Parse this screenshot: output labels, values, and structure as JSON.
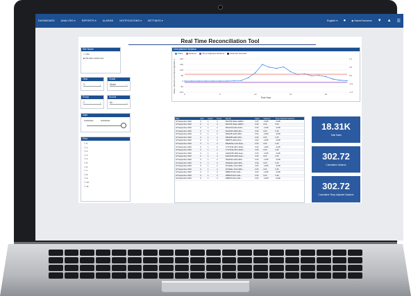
{
  "nav": {
    "items": [
      "DASHBOARD",
      "ANALYSIS ▾",
      "REPORTS ▾",
      "ALARMS",
      "NOTIFICATIONS ▾",
      "SETTINGS ▾"
    ],
    "language": "English ▾",
    "user": "NameSurname"
  },
  "page": {
    "title": "Real Time Reconciliation Tool"
  },
  "site": {
    "header": "Site Name",
    "options": [
      "(All)",
      "ON-Main Addersons"
    ]
  },
  "tank": {
    "header": "Tank",
    "value": "3"
  },
  "grade": {
    "header": "Grade",
    "value": "Diesel"
  },
  "pump": {
    "header": "Pump",
    "value": "2"
  },
  "nozzle": {
    "header": "Nozzle",
    "value": "All"
  },
  "date": {
    "header": "Date",
    "start": "9/18/2020",
    "end": "9/18/2020"
  },
  "hour": {
    "header": "Hour",
    "values": [
      "0",
      "1",
      "2",
      "3",
      "4",
      "5",
      "6",
      "7",
      "8",
      "9",
      "10",
      "11"
    ]
  },
  "chart_data": {
    "type": "line",
    "title": "Unexplained Variance",
    "legend": [
      "Sales",
      "Variance",
      "Temp Adjusted Variance",
      "Selected Intervals"
    ],
    "ylabel": "Sales, Variance and Temp Adjusted V...",
    "xlabel": "Time Hour",
    "x": [
      0,
      1,
      2,
      3,
      4,
      5,
      6,
      7,
      8,
      9,
      10,
      11,
      12,
      13,
      14,
      15,
      16,
      17,
      18,
      19,
      20,
      21,
      22,
      23
    ],
    "ylim": [
      -100,
      200
    ],
    "y_ticks": [
      "200",
      "150",
      "100",
      "50",
      "0",
      "-50",
      "-100"
    ],
    "y2_ticks": [
      "1.0",
      "0.5",
      "0.0",
      "-0.5",
      "-1.0"
    ],
    "x_ticks": [
      "0",
      "5",
      "10",
      "15",
      "20"
    ],
    "colors": {
      "sales": "#2f86e0",
      "variance": "#e64b3c",
      "temp": "#8a3cc4",
      "selected": "#222222"
    },
    "series": [
      {
        "name": "Sales",
        "values": [
          0,
          0,
          0,
          0,
          0,
          0,
          0,
          2,
          5,
          30,
          75,
          150,
          125,
          115,
          128,
          85,
          60,
          65,
          48,
          52,
          40,
          18,
          8,
          4
        ]
      },
      {
        "name": "Temp Adjusted Variance",
        "values": [
          -11.5,
          -11.5,
          -11.5,
          -11.5,
          -11.5,
          -11.5,
          -11.5,
          -11.5,
          -11.5,
          -11.5,
          -11.5,
          -11.5,
          -11.5,
          -11.5,
          -11.5,
          -11.5,
          -11.5,
          -11.5,
          -11.5,
          -11.5,
          -11.5,
          -11.5,
          -11.5,
          -11.5
        ]
      },
      {
        "name": "Variance",
        "values": [
          62,
          62,
          62,
          62,
          62,
          62,
          62,
          62,
          62,
          62,
          62,
          62,
          62,
          62,
          62,
          62,
          62,
          62,
          62,
          62,
          62,
          62,
          62,
          62
        ]
      }
    ]
  },
  "table": {
    "columns": [
      "Date",
      "Hour",
      "Grade",
      "Pump",
      "Nozzle",
      "Sales",
      "Variance",
      "Temp Adjusted Variance"
    ],
    "rows": [
      [
        "18 September 2020",
        "0",
        "1",
        "2",
        "0f2e7f2b-9bae-4e88-b...",
        "0.00",
        "-11.86",
        "-11.86"
      ],
      [
        "18 September 2020",
        "0",
        "1",
        "2",
        "0f2e7f2b-9bae-4e88-b...",
        "0.00",
        "0.00",
        "0.00"
      ],
      [
        "18 September 2020",
        "0",
        "1",
        "2",
        "0f6e1139-ba0e-4b44-...",
        "0.00",
        "-11.86",
        "-11.86"
      ],
      [
        "18 September 2020",
        "0",
        "1",
        "2",
        "0f4e2915-4b69-4fc0-...",
        "0.00",
        "0.00",
        "0.00"
      ],
      [
        "18 September 2020",
        "0",
        "1",
        "2",
        "0f84e25f-a643-4f60-...",
        "0.00",
        "-11.86",
        "-11.86"
      ],
      [
        "18 September 2020",
        "0",
        "1",
        "2",
        "0f8a2b83-afd3-4b0f-...",
        "0.00",
        "0.00",
        "0.00"
      ],
      [
        "18 September 2020",
        "0",
        "1",
        "2",
        "0f8f2f7b-a0d1-4bce-...",
        "0.00",
        "-11.86",
        "-11.86"
      ],
      [
        "18 September 2020",
        "0",
        "1",
        "2",
        "0f8e09f1a-ce42-4ba4-...",
        "0.00",
        "0.00",
        "0.00"
      ],
      [
        "18 September 2020",
        "0",
        "1",
        "2",
        "17727194-d57e-4b0d-...",
        "0.00",
        "-11.86",
        "-11.86"
      ],
      [
        "18 September 2020",
        "0",
        "1",
        "2",
        "17727194-d57e-4b0d-...",
        "0.00",
        "0.00",
        "0.00"
      ],
      [
        "18 September 2020",
        "0",
        "1",
        "2",
        "2a933d78-4320-4a1e-...",
        "0.00",
        "-11.86",
        "-11.86"
      ],
      [
        "18 September 2020",
        "0",
        "1",
        "2",
        "2a933d78-4320-4a1e-...",
        "0.00",
        "0.00",
        "0.00"
      ],
      [
        "18 September 2020",
        "0",
        "1",
        "2",
        "2f6a3b2b-2de6-4f29-...",
        "0.00",
        "-11.86",
        "-11.86"
      ],
      [
        "18 September 2020",
        "0",
        "1",
        "2",
        "2f6a3b2b-2de6-4f29-...",
        "0.00",
        "0.00",
        "0.00"
      ],
      [
        "18 September 2020",
        "0",
        "1",
        "2",
        "2f7a9d2e-71e6-4b8c-...",
        "0.00",
        "-11.86",
        "-11.86"
      ],
      [
        "18 September 2020",
        "0",
        "1",
        "2",
        "2f7a9d2e-71e6-4b8c-...",
        "0.00",
        "0.00",
        "0.00"
      ],
      [
        "18 September 2020",
        "0",
        "1",
        "2",
        "2f8f6b78-2fc1-4ef1-...",
        "0.00",
        "-11.86",
        "-11.86"
      ],
      [
        "18 September 2020",
        "0",
        "1",
        "2",
        "2f8f6b78-2fc1-4ef1-...",
        "0.00",
        "0.00",
        "0.00"
      ],
      [
        "18 September 2020",
        "0",
        "1",
        "2",
        "2f8f6b78-2fc1-4ef1-...",
        "0.00",
        "-11.86",
        "-11.86"
      ]
    ]
  },
  "cards": [
    {
      "value": "18.31K",
      "label": "Total Sales"
    },
    {
      "value": "302.72",
      "label": "Cumulative Variance"
    },
    {
      "value": "302.72",
      "label": "Cumulative Temp Adjusted Variance"
    }
  ]
}
